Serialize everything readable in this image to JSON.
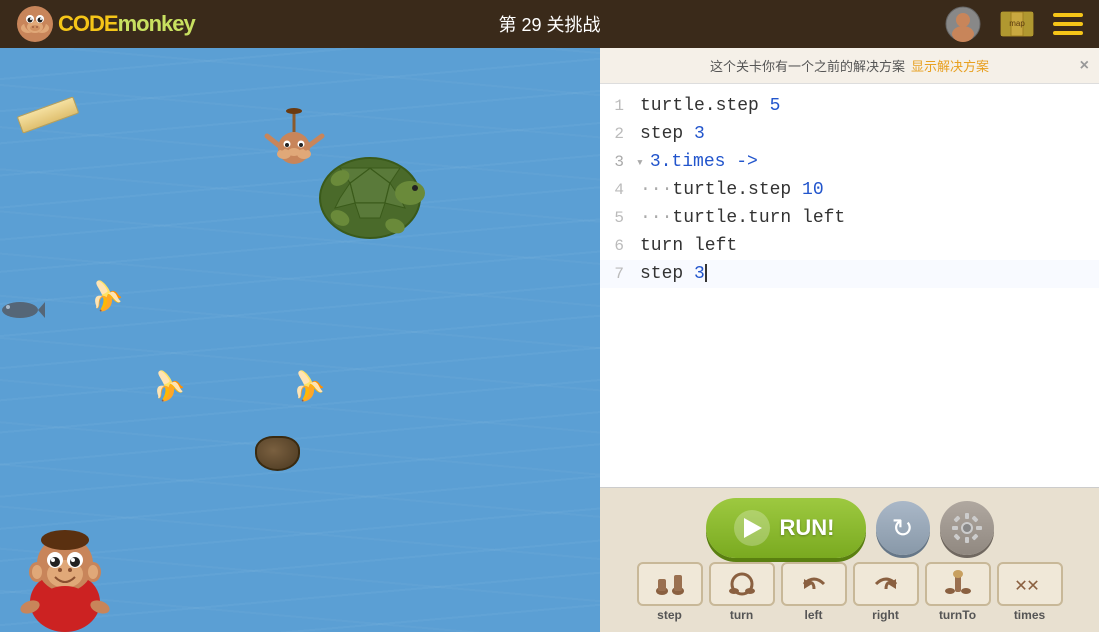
{
  "header": {
    "title": "第 29 关挑战",
    "logo_text_code": "CODE",
    "logo_text_monkey": "monkey"
  },
  "notification": {
    "text": "这个关卡你有一个之前的解决方案",
    "link_text": "显示解决方案",
    "close_label": "×"
  },
  "code_lines": [
    {
      "num": "1",
      "content": "turtle.step 5",
      "type": "normal"
    },
    {
      "num": "2",
      "content": "step 3",
      "type": "normal"
    },
    {
      "num": "3",
      "content": "3.times ->",
      "type": "times"
    },
    {
      "num": "4",
      "content": "···turtle.step 10",
      "type": "indented"
    },
    {
      "num": "5",
      "content": "···turtle.turn left",
      "type": "indented"
    },
    {
      "num": "6",
      "content": "turn left",
      "type": "normal"
    },
    {
      "num": "7",
      "content": "step 3",
      "type": "cursor"
    }
  ],
  "buttons": {
    "run_label": "RUN!",
    "reset_title": "Reset",
    "settings_title": "Settings"
  },
  "command_blocks": [
    {
      "id": "step",
      "label": "step"
    },
    {
      "id": "turn",
      "label": "turn"
    },
    {
      "id": "left",
      "label": "left"
    },
    {
      "id": "right",
      "label": "right"
    },
    {
      "id": "turnTo",
      "label": "turnTo"
    },
    {
      "id": "times",
      "label": "times"
    }
  ],
  "game": {
    "bg_color": "#5b9fd4"
  }
}
